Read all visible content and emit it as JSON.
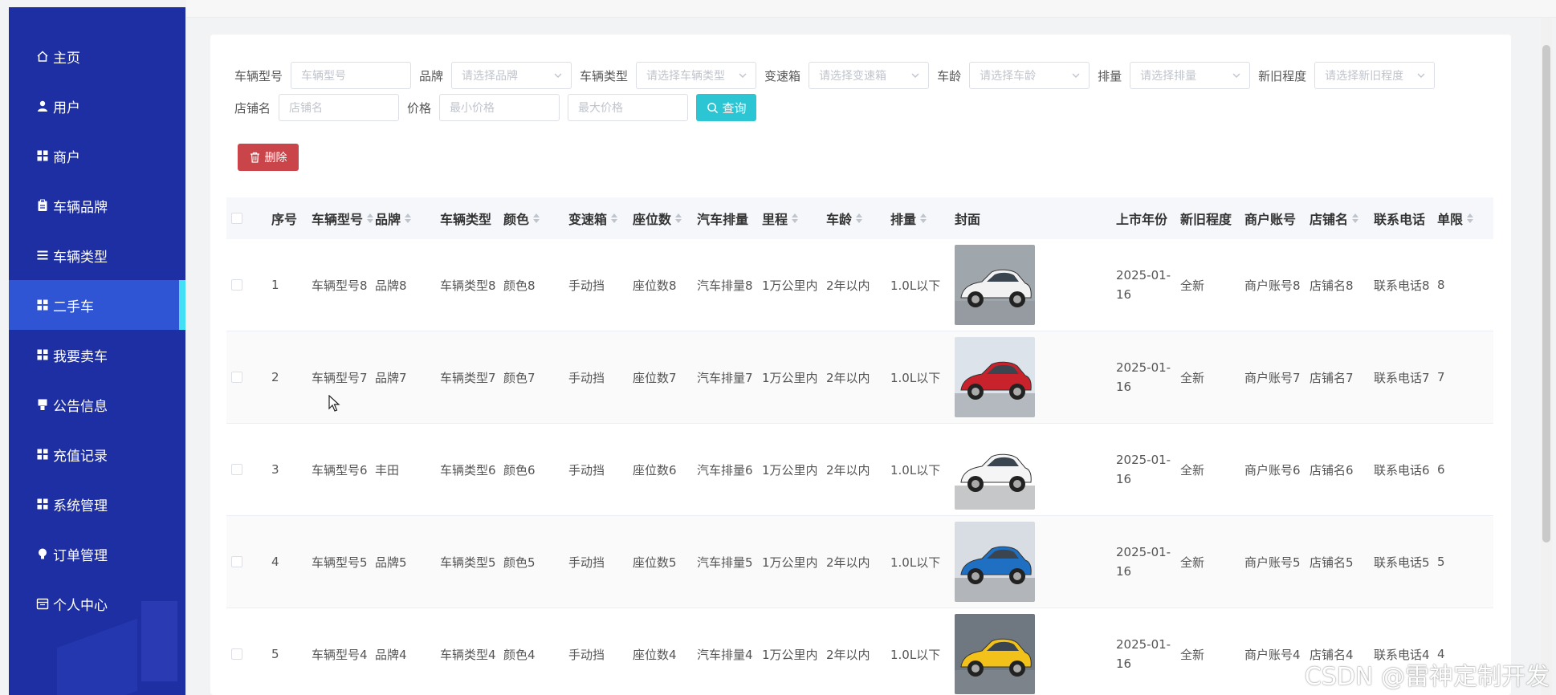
{
  "sidebar": {
    "items": [
      {
        "label": "主页",
        "icon": "home-icon"
      },
      {
        "label": "用户",
        "icon": "user-icon"
      },
      {
        "label": "商户",
        "icon": "grid-icon"
      },
      {
        "label": "车辆品牌",
        "icon": "clipboard-icon"
      },
      {
        "label": "车辆类型",
        "icon": "list-icon"
      },
      {
        "label": "二手车",
        "icon": "grid-icon"
      },
      {
        "label": "我要卖车",
        "icon": "grid-icon"
      },
      {
        "label": "公告信息",
        "icon": "bell-icon"
      },
      {
        "label": "充值记录",
        "icon": "grid-icon"
      },
      {
        "label": "系统管理",
        "icon": "grid-icon"
      },
      {
        "label": "订单管理",
        "icon": "lightbulb-icon"
      },
      {
        "label": "个人中心",
        "icon": "calendar-icon"
      }
    ],
    "active_index": 5,
    "colors": {
      "bg": "#1e2fa3",
      "active": "#2f55d4",
      "active_bar": "#41e0f4"
    }
  },
  "filters": {
    "model": {
      "label": "车辆型号",
      "placeholder": "车辆型号"
    },
    "brand": {
      "label": "品牌",
      "placeholder": "请选择品牌"
    },
    "type": {
      "label": "车辆类型",
      "placeholder": "请选择车辆类型"
    },
    "gearbox": {
      "label": "变速箱",
      "placeholder": "请选择变速箱"
    },
    "age": {
      "label": "车龄",
      "placeholder": "请选择车龄"
    },
    "displacement": {
      "label": "排量",
      "placeholder": "请选择排量"
    },
    "condition": {
      "label": "新旧程度",
      "placeholder": "请选择新旧程度"
    },
    "shop": {
      "label": "店铺名",
      "placeholder": "店铺名"
    },
    "price": {
      "label": "价格",
      "min_placeholder": "最小价格",
      "max_placeholder": "最大价格"
    },
    "query_label": "查询"
  },
  "actions": {
    "delete_label": "删除"
  },
  "table": {
    "headers": {
      "index": "序号",
      "model": "车辆型号",
      "brand": "品牌",
      "type": "车辆类型",
      "color": "颜色",
      "gearbox": "变速箱",
      "seats": "座位数",
      "displacement": "汽车排量",
      "mileage": "里程",
      "age": "车龄",
      "volume": "排量",
      "cover": "封面",
      "year": "上市年份",
      "condition": "新旧程度",
      "account": "商户账号",
      "shop": "店铺名",
      "phone": "联系电话",
      "limit": "单限"
    },
    "rows": [
      {
        "index": "1",
        "model": "车辆型号8",
        "brand": "品牌8",
        "type": "车辆类型8",
        "color": "颜色8",
        "gearbox": "手动挡",
        "seats": "座位数8",
        "displacement": "汽车排量8",
        "mileage": "1万公里内",
        "age": "2年以内",
        "volume": "1.0L以下",
        "year": "2025-01-16",
        "condition": "全新",
        "account": "商户账号8",
        "shop": "店铺名8",
        "phone": "联系电话8",
        "limit": "8",
        "car_color": "#f2f2f2",
        "bg": "#9fa7ad"
      },
      {
        "index": "2",
        "model": "车辆型号7",
        "brand": "品牌7",
        "type": "车辆类型7",
        "color": "颜色7",
        "gearbox": "手动挡",
        "seats": "座位数7",
        "displacement": "汽车排量7",
        "mileage": "1万公里内",
        "age": "2年以内",
        "volume": "1.0L以下",
        "year": "2025-01-16",
        "condition": "全新",
        "account": "商户账号7",
        "shop": "店铺名7",
        "phone": "联系电话7",
        "limit": "7",
        "car_color": "#c8232c",
        "bg": "#dde3ea"
      },
      {
        "index": "3",
        "model": "车辆型号6",
        "brand": "丰田",
        "type": "车辆类型6",
        "color": "颜色6",
        "gearbox": "手动挡",
        "seats": "座位数6",
        "displacement": "汽车排量6",
        "mileage": "1万公里内",
        "age": "2年以内",
        "volume": "1.0L以下",
        "year": "2025-01-16",
        "condition": "全新",
        "account": "商户账号6",
        "shop": "店铺名6",
        "phone": "联系电话6",
        "limit": "6",
        "car_color": "#f5f5f5",
        "bg": "#ffffff"
      },
      {
        "index": "4",
        "model": "车辆型号5",
        "brand": "品牌5",
        "type": "车辆类型5",
        "color": "颜色5",
        "gearbox": "手动挡",
        "seats": "座位数5",
        "displacement": "汽车排量5",
        "mileage": "1万公里内",
        "age": "2年以内",
        "volume": "1.0L以下",
        "year": "2025-01-16",
        "condition": "全新",
        "account": "商户账号5",
        "shop": "店铺名5",
        "phone": "联系电话5",
        "limit": "5",
        "car_color": "#1f6fc2",
        "bg": "#d8dde3"
      },
      {
        "index": "5",
        "model": "车辆型号4",
        "brand": "品牌4",
        "type": "车辆类型4",
        "color": "颜色4",
        "gearbox": "手动挡",
        "seats": "座位数4",
        "displacement": "汽车排量4",
        "mileage": "1万公里内",
        "age": "2年以内",
        "volume": "1.0L以下",
        "year": "2025-01-16",
        "condition": "全新",
        "account": "商户账号4",
        "shop": "店铺名4",
        "phone": "联系电话4",
        "limit": "4",
        "car_color": "#f2c21a",
        "bg": "#6f7780"
      }
    ]
  },
  "watermark": "CSDN @雷神定制开发"
}
